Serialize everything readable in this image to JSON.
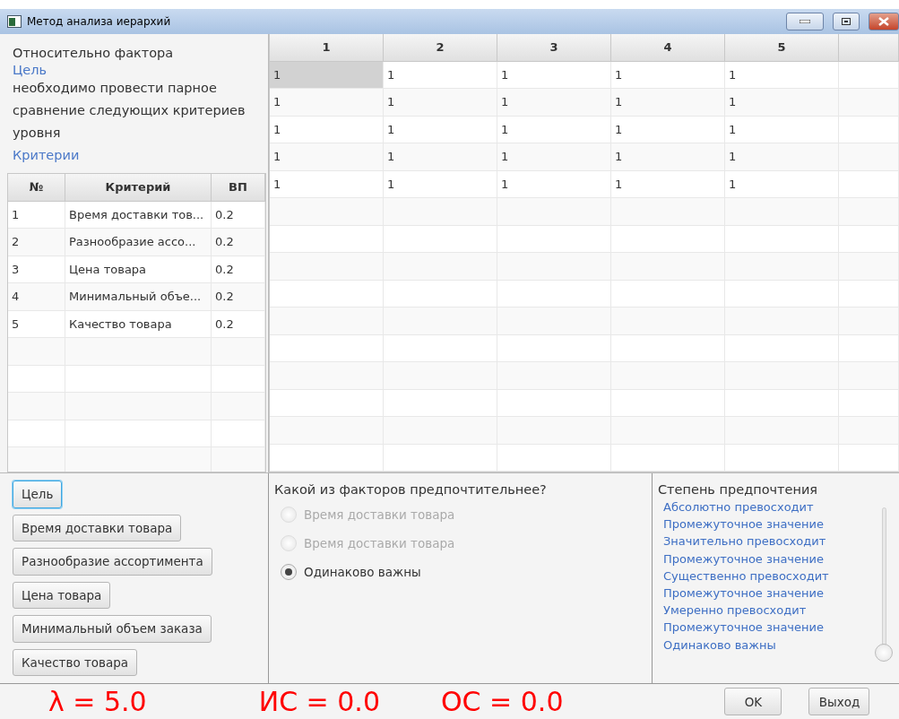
{
  "window": {
    "title": "Метод анализа иерархий"
  },
  "info": {
    "prefix": "Относительно фактора",
    "factor": "Цель",
    "text": "необходимо провести парное сравнение следующих критериев уровня",
    "level_name": "Критерии"
  },
  "criteria_table": {
    "columns": [
      "№",
      "Критерий",
      "ВП"
    ],
    "rows": [
      [
        "1",
        "Время доставки тов...",
        "0.2"
      ],
      [
        "2",
        "Разнообразие ассо...",
        "0.2"
      ],
      [
        "3",
        "Цена товара",
        "0.2"
      ],
      [
        "4",
        "Минимальный объе...",
        "0.2"
      ],
      [
        "5",
        "Качество товара",
        "0.2"
      ]
    ]
  },
  "matrix": {
    "columns": [
      "1",
      "2",
      "3",
      "4",
      "5"
    ],
    "rows": [
      {
        "cells": [
          {
            "value": "1",
            "selected": true
          },
          {
            "value": "1",
            "selected": false
          },
          {
            "value": "1",
            "selected": false
          },
          {
            "value": "1",
            "selected": false
          },
          {
            "value": "1",
            "selected": false
          }
        ]
      },
      {
        "cells": [
          {
            "value": "1",
            "selected": false
          },
          {
            "value": "1",
            "selected": false
          },
          {
            "value": "1",
            "selected": false
          },
          {
            "value": "1",
            "selected": false
          },
          {
            "value": "1",
            "selected": false
          }
        ]
      },
      {
        "cells": [
          {
            "value": "1",
            "selected": false
          },
          {
            "value": "1",
            "selected": false
          },
          {
            "value": "1",
            "selected": false
          },
          {
            "value": "1",
            "selected": false
          },
          {
            "value": "1",
            "selected": false
          }
        ]
      },
      {
        "cells": [
          {
            "value": "1",
            "selected": false
          },
          {
            "value": "1",
            "selected": false
          },
          {
            "value": "1",
            "selected": false
          },
          {
            "value": "1",
            "selected": false
          },
          {
            "value": "1",
            "selected": false
          }
        ]
      },
      {
        "cells": [
          {
            "value": "1",
            "selected": false
          },
          {
            "value": "1",
            "selected": false
          },
          {
            "value": "1",
            "selected": false
          },
          {
            "value": "1",
            "selected": false
          },
          {
            "value": "1",
            "selected": false
          }
        ]
      }
    ]
  },
  "factor_buttons": [
    {
      "label": "Цель",
      "focused": true
    },
    {
      "label": "Время доставки товара",
      "focused": false
    },
    {
      "label": "Разнообразие ассортимента",
      "focused": false
    },
    {
      "label": "Цена товара",
      "focused": false
    },
    {
      "label": "Минимальный объем заказа",
      "focused": false
    },
    {
      "label": "Качество товара",
      "focused": false
    }
  ],
  "question": {
    "title": "Какой из факторов предпочтительнее?",
    "options": [
      {
        "label": "Время доставки товара",
        "selected": false,
        "disabled": true
      },
      {
        "label": "Время доставки товара",
        "selected": false,
        "disabled": true
      },
      {
        "label": "Одинаково важны",
        "selected": true,
        "disabled": false
      }
    ]
  },
  "preference": {
    "title": "Степень предпочтения",
    "levels": [
      "Абсолютно превосходит",
      "Промежуточное значение",
      "Значительно превосходит",
      "Промежуточное значение",
      "Существенно превосходит",
      "Промежуточное значение",
      "Умеренно превосходит",
      "Промежуточное значение",
      "Одинаково важны"
    ],
    "slider": {
      "level": 0
    }
  },
  "footer": {
    "stats": [
      "λ = 5.0",
      "ИС = 0.0",
      "ОС = 0.0"
    ],
    "buttons": [
      "OK",
      "Выход"
    ]
  }
}
